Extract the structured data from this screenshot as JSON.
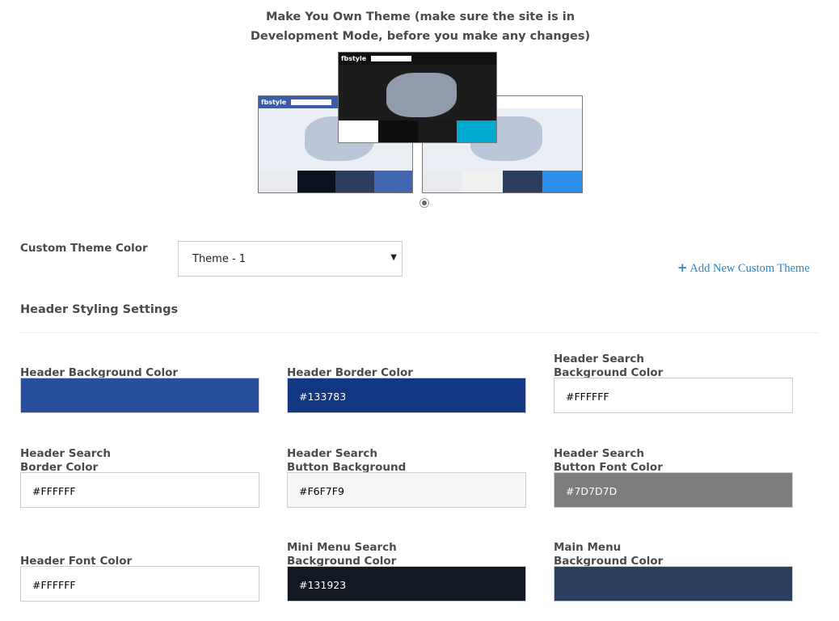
{
  "title": "Make You Own Theme (make sure the site is in Development Mode, before you make any changes)",
  "previews": [
    {
      "brand": "fbstyle",
      "header": "#3b5ca8",
      "bg": "#e9edf4",
      "swatches": [
        "#e9ebee",
        "#0a1120",
        "#2c3e60",
        "#4267b2"
      ]
    },
    {
      "brand": "fbstyle",
      "header": "#111111",
      "bg": "#1c1c1c",
      "swatches": [
        "#ffffff",
        "#0d0d0d",
        "#1a1a1a",
        "#00a9d0"
      ]
    },
    {
      "brand": "",
      "header": "#ffffff",
      "bg": "#e9edf4",
      "swatches": [
        "#e9ebee",
        "#f0f0f0",
        "#2c3e60",
        "#2d8eeb"
      ]
    }
  ],
  "custom_theme": {
    "label": "Custom Theme Color",
    "selected": "Theme - 1",
    "add_label": "Add New Custom Theme"
  },
  "section_title": "Header Styling Settings",
  "fields": [
    {
      "label": "Header Background Color",
      "value": "",
      "bg": "#274d9b",
      "fg": "#ffffff"
    },
    {
      "label": "Header Border Color",
      "value": "#133783",
      "bg": "#133783",
      "fg": "#ffffff"
    },
    {
      "label": "Header Search Background Color",
      "value": "#FFFFFF",
      "bg": "#ffffff",
      "fg": "#000000"
    },
    {
      "label": "Header Search Border Color",
      "value": "#FFFFFF",
      "bg": "#ffffff",
      "fg": "#000000"
    },
    {
      "label": "Header Search Button Background Color",
      "value": "#F6F7F9",
      "bg": "#f5f6f8",
      "fg": "#000000"
    },
    {
      "label": "Header Search Button Font Color",
      "value": "#7D7D7D",
      "bg": "#7d7d7d",
      "fg": "#ffffff"
    },
    {
      "label": "Header Font Color",
      "value": "#FFFFFF",
      "bg": "#ffffff",
      "fg": "#000000"
    },
    {
      "label": "Mini Menu Search Background Color",
      "value": "#131923",
      "bg": "#131923",
      "fg": "#ffffff"
    },
    {
      "label": "Main Menu Background Color",
      "value": "",
      "bg": "#2c3e60",
      "fg": "#ffffff"
    }
  ]
}
